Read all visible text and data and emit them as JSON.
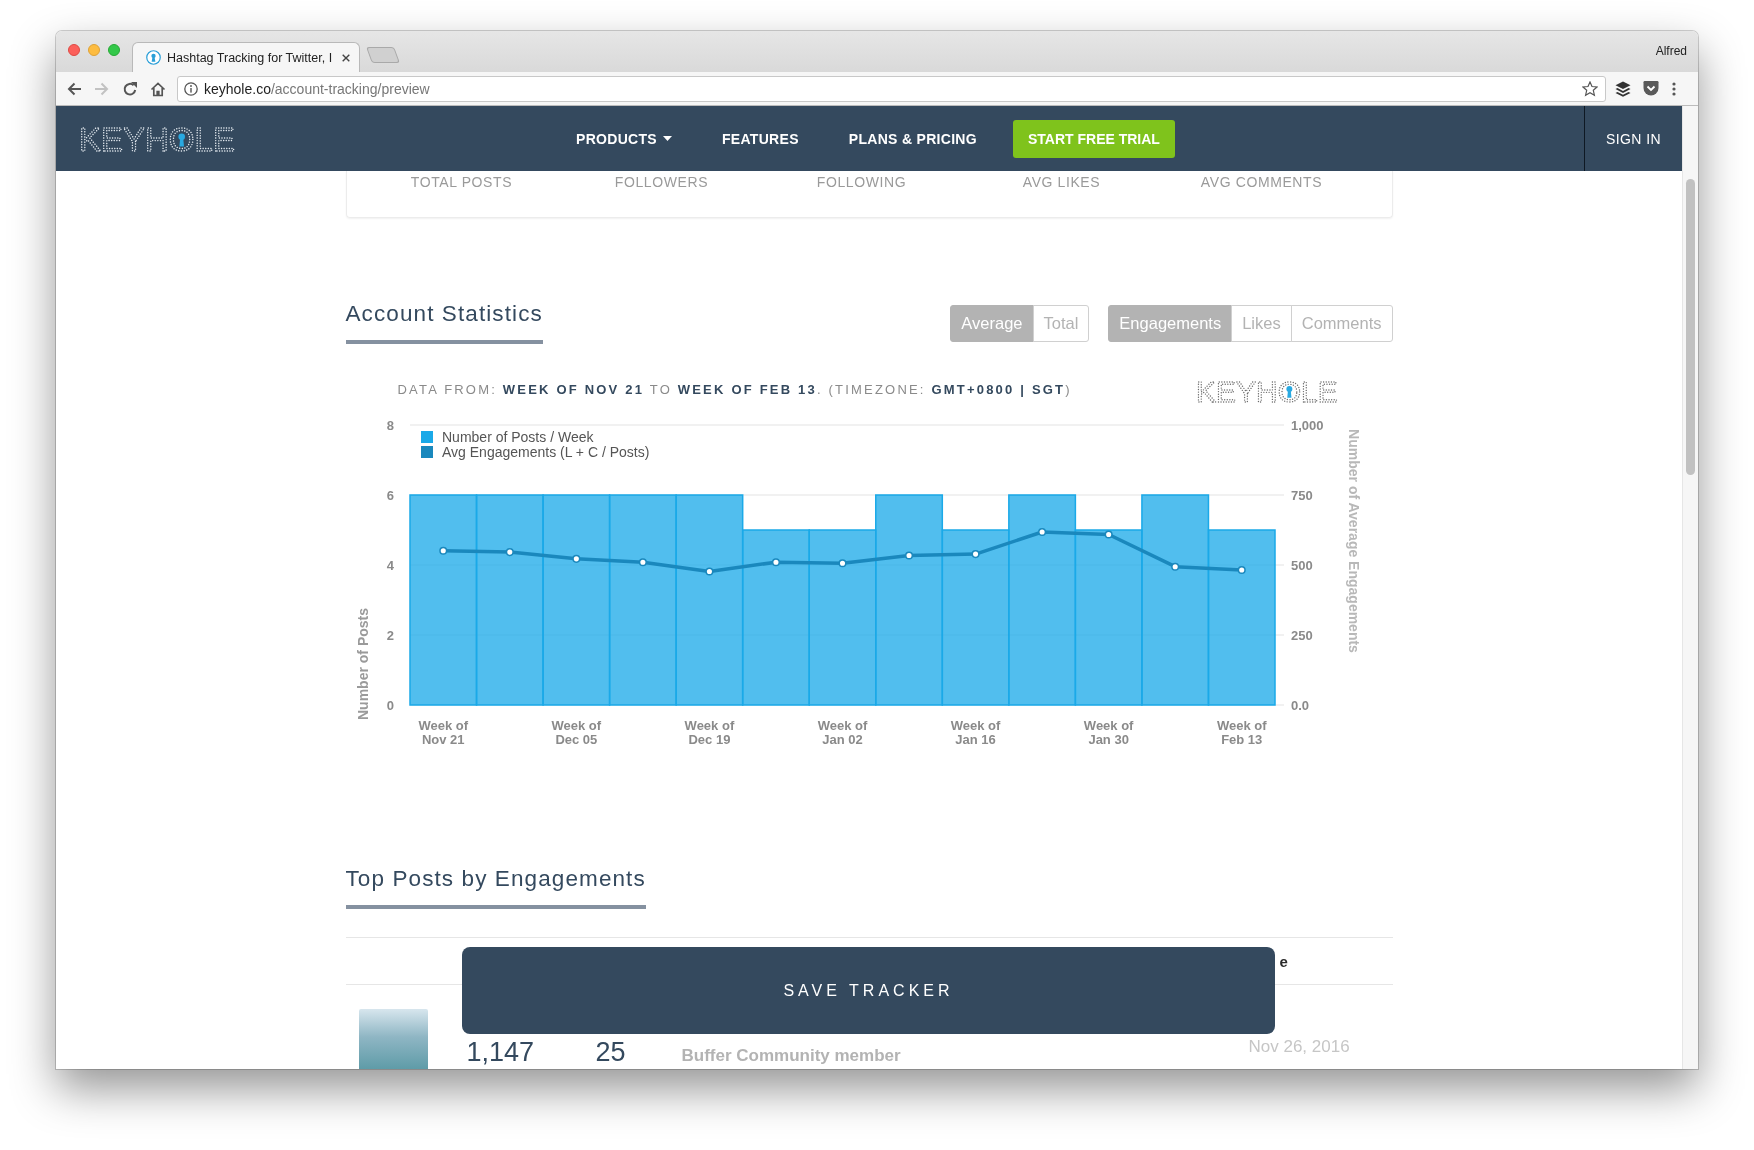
{
  "browser": {
    "tabs": [
      {
        "title": "Hashtag Tracking for Twitter, I",
        "selected": true
      }
    ],
    "profile": "Alfred",
    "nav_buttons": [
      {
        "kind": "back",
        "disabled": false
      },
      {
        "kind": "forward",
        "disabled": true
      },
      {
        "kind": "reload",
        "disabled": false
      },
      {
        "kind": "home",
        "disabled": false
      }
    ],
    "address": {
      "host": "keyhole.co",
      "path": "/account-tracking/preview"
    }
  },
  "nav": {
    "logo": "KEYHOLE",
    "items": [
      {
        "label": "PRODUCTS",
        "dropdown": true
      },
      {
        "label": "FEATURES",
        "dropdown": false
      },
      {
        "label": "PLANS & PRICING",
        "dropdown": false
      }
    ],
    "cta": "START FREE TRIAL",
    "sign_in": "SIGN IN"
  },
  "summary": {
    "labels": [
      "TOTAL POSTS",
      "FOLLOWERS",
      "FOLLOWING",
      "AVG LIKES",
      "AVG COMMENTS"
    ]
  },
  "account_statistics": {
    "title": "Account Statistics",
    "mode_toggle": [
      {
        "label": "Average",
        "selected": true
      },
      {
        "label": "Total",
        "selected": false
      }
    ],
    "metric_toggle": [
      {
        "label": "Engagements",
        "selected": true
      },
      {
        "label": "Likes",
        "selected": false
      },
      {
        "label": "Comments",
        "selected": false
      }
    ],
    "data_range": "DATA FROM: **WEEK OF NOV 21** TO **WEEK OF FEB 13**. (TIMEZONE: **GMT+0800 | SGT**)",
    "logo": "KEYHOLE",
    "chart_data": {
      "type": "bar",
      "ylabel": "Number of Posts",
      "y2label": "Number of Average Engagements",
      "categories": [
        "Week of Nov 21",
        null,
        "Week of Dec 05",
        null,
        "Week of Dec 19",
        null,
        "Week of Jan 02",
        null,
        "Week of Jan 16",
        null,
        "Week of Jan 30",
        null,
        "Week of Feb 13"
      ],
      "ylim": [
        0,
        8
      ],
      "yticks": [
        0,
        2,
        4,
        6,
        8
      ],
      "y2lim": [
        0,
        1000
      ],
      "y2ticks": [
        {
          "value": 0,
          "label": "0.0"
        },
        250,
        500,
        750,
        {
          "value": 1000,
          "label": "1,000"
        }
      ],
      "grid": true,
      "legend": true,
      "series": [
        {
          "name": "Number of Posts / Week",
          "color": "#1aa9e8",
          "values": [
            6,
            6,
            6,
            6,
            6,
            5,
            5,
            6,
            5,
            6,
            5,
            6,
            5
          ]
        },
        {
          "name": "Avg Engagements (L + C / Posts)",
          "color": "#1a88bd",
          "type": "line",
          "axis": "y2",
          "marker": "circle",
          "values": [
            551,
            546,
            522,
            510,
            477,
            510,
            506,
            534,
            539,
            618,
            609,
            494,
            482
          ]
        }
      ]
    }
  },
  "top_posts": {
    "title": "Top Posts by Engagements",
    "header": {
      "column_6": "e"
    },
    "rows": [
      {
        "column_2": "1,147",
        "column_3": "25",
        "column_4": "Buffer Community member",
        "column_6": "Nov 26, 2016"
      }
    ]
  },
  "save_button": "SAVE TRACKER"
}
